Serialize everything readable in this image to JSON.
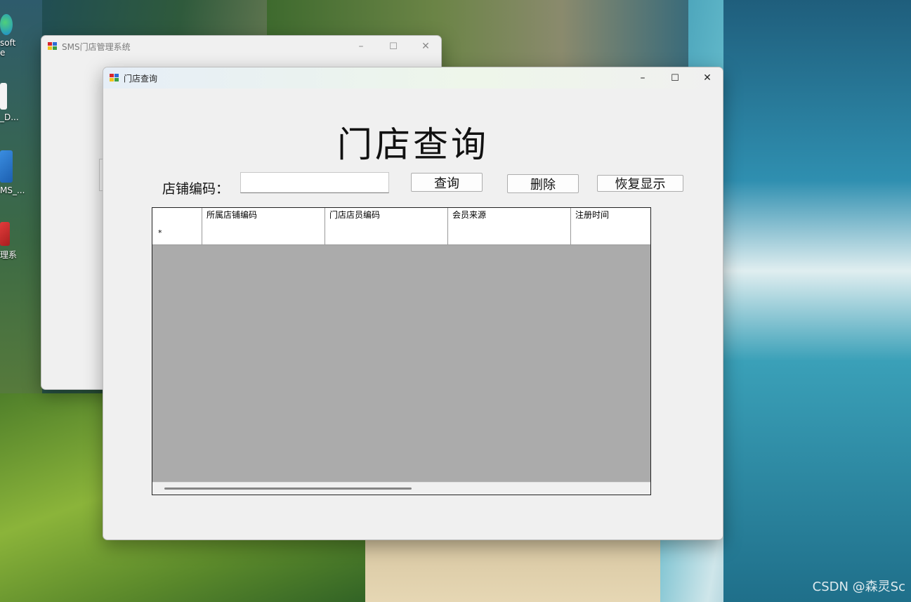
{
  "desktop": {
    "icons": [
      {
        "label": "soft",
        "label2": "e"
      },
      {
        "label": "_D..."
      },
      {
        "label": "MS_..."
      },
      {
        "label": "理系"
      }
    ],
    "watermark": "CSDN @森灵Sc"
  },
  "main_window": {
    "title": "SMS门店管理系统",
    "minimize": "–",
    "maximize": "☐",
    "close": "✕"
  },
  "query_window": {
    "title": "门店查询",
    "minimize": "–",
    "maximize": "☐",
    "close": "✕",
    "heading": "门店查询",
    "store_code_label": "店铺编码：",
    "store_code_value": "",
    "query_button": "查询",
    "delete_button": "删除",
    "restore_button": "恢复显示",
    "grid": {
      "columns": [
        "所属店铺编码",
        "门店店员编码",
        "会员来源",
        "注册时间"
      ],
      "new_row_marker": "*"
    }
  },
  "colors": {
    "window_bg": "#f0f0f0",
    "grid_empty_bg": "#ababab",
    "icon_red": "#d9262b",
    "icon_blue": "#2b6cd6",
    "icon_yellow": "#f2c41a",
    "icon_green": "#3da043"
  }
}
